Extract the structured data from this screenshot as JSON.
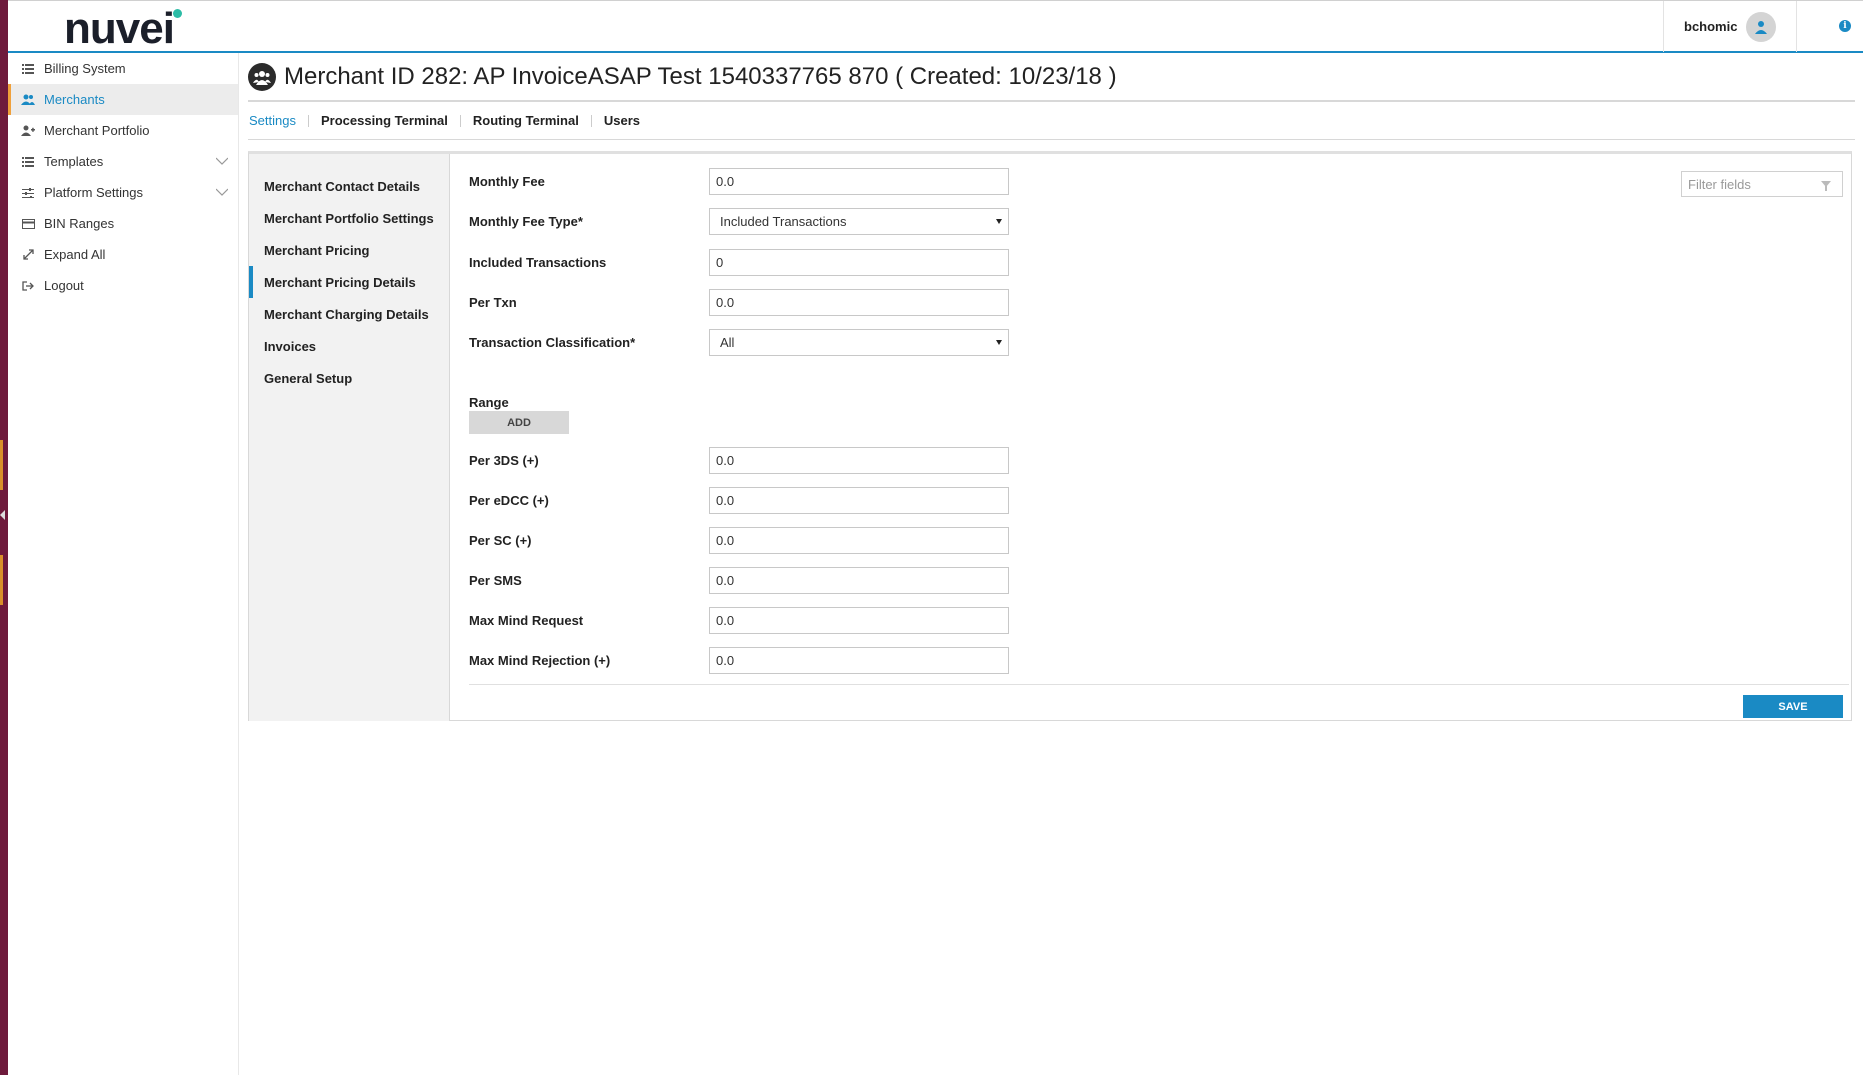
{
  "app": {
    "logo_text": "nuvei"
  },
  "header": {
    "username": "bchomic"
  },
  "sidebar": {
    "items": [
      {
        "label": "Billing System"
      },
      {
        "label": "Merchants"
      },
      {
        "label": "Merchant Portfolio"
      },
      {
        "label": "Templates"
      },
      {
        "label": "Platform Settings"
      },
      {
        "label": "BIN Ranges"
      },
      {
        "label": "Expand All"
      },
      {
        "label": "Logout"
      }
    ]
  },
  "page": {
    "title": "Merchant ID 282: AP InvoiceASAP Test 1540337765 870 ( Created: 10/23/18 )"
  },
  "tabs": [
    {
      "label": "Settings"
    },
    {
      "label": "Processing Terminal"
    },
    {
      "label": "Routing Terminal"
    },
    {
      "label": "Users"
    }
  ],
  "subnav": [
    {
      "label": "Merchant Contact Details"
    },
    {
      "label": "Merchant Portfolio Settings"
    },
    {
      "label": "Merchant Pricing"
    },
    {
      "label": "Merchant Pricing Details"
    },
    {
      "label": "Merchant Charging Details"
    },
    {
      "label": "Invoices"
    },
    {
      "label": "General Setup"
    }
  ],
  "form": {
    "monthly_fee": {
      "label": "Monthly Fee",
      "value": "0.0"
    },
    "monthly_fee_type": {
      "label": "Monthly Fee Type*",
      "value": "Included Transactions"
    },
    "included_transactions": {
      "label": "Included Transactions",
      "value": "0"
    },
    "per_txn": {
      "label": "Per Txn",
      "value": "0.0"
    },
    "transaction_classification": {
      "label": "Transaction Classification*",
      "value": "All"
    },
    "range": {
      "label": "Range",
      "add_label": "ADD"
    },
    "per_3ds": {
      "label": "Per 3DS (+)",
      "value": "0.0"
    },
    "per_edcc": {
      "label": "Per eDCC (+)",
      "value": "0.0"
    },
    "per_sc": {
      "label": "Per SC (+)",
      "value": "0.0"
    },
    "per_sms": {
      "label": "Per SMS",
      "value": "0.0"
    },
    "max_mind_request": {
      "label": "Max Mind Request",
      "value": "0.0"
    },
    "max_mind_rejection": {
      "label": "Max Mind Rejection (+)",
      "value": "0.0"
    },
    "save_label": "SAVE"
  },
  "filter": {
    "placeholder": "Filter fields"
  },
  "colors": {
    "accent": "#1a8ac4",
    "active_marker": "#f0a03a",
    "left_strip": "#6e1a3c"
  }
}
